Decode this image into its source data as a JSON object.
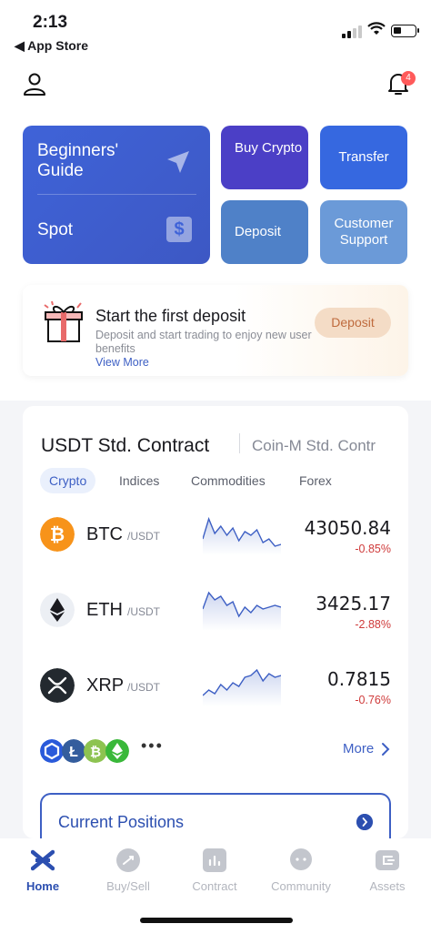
{
  "status_bar": {
    "time": "2:13",
    "back_app": "◀ App Store"
  },
  "header": {
    "notification_count": "4"
  },
  "quick_actions": {
    "beginners_guide": "Beginners' Guide",
    "spot": "Spot",
    "buy_crypto": "Buy Crypto",
    "transfer": "Transfer",
    "deposit": "Deposit",
    "customer_support": "Customer Support"
  },
  "promo": {
    "title": "Start the first deposit",
    "description": "Deposit and start trading to enjoy new user benefits",
    "link": "View More",
    "button": "Deposit"
  },
  "market": {
    "tabs": [
      "USDT Std. Contract",
      "Coin-M Std. Contr"
    ],
    "chips": [
      "Crypto",
      "Indices",
      "Commodities",
      "Forex"
    ],
    "coins": [
      {
        "symbol": "BTC",
        "pair": "/USDT",
        "price": "43050.84",
        "change": "-0.85%",
        "logo_color": "#f7931a",
        "sparkline": [
          0.7,
          0.15,
          0.55,
          0.35,
          0.6,
          0.4,
          0.75,
          0.5,
          0.6,
          0.45,
          0.8,
          0.7,
          0.9,
          0.85
        ]
      },
      {
        "symbol": "ETH",
        "pair": "/USDT",
        "price": "3425.17",
        "change": "-2.88%",
        "logo_color": "#627eea",
        "sparkline": [
          0.55,
          0.1,
          0.3,
          0.2,
          0.45,
          0.35,
          0.75,
          0.5,
          0.65,
          0.45,
          0.55,
          0.5,
          0.45,
          0.5
        ]
      },
      {
        "symbol": "XRP",
        "pair": "/USDT",
        "price": "0.7815",
        "change": "-0.76%",
        "logo_color": "#23292f",
        "sparkline": [
          0.85,
          0.7,
          0.8,
          0.55,
          0.7,
          0.5,
          0.6,
          0.35,
          0.3,
          0.15,
          0.45,
          0.25,
          0.35,
          0.3
        ]
      }
    ],
    "more_label": "More",
    "dots": "•••",
    "current_positions": "Current Positions"
  },
  "tab_bar": {
    "items": [
      {
        "label": "Home",
        "icon": "home-logo-icon"
      },
      {
        "label": "Buy/Sell",
        "icon": "buy-sell-icon"
      },
      {
        "label": "Contract",
        "icon": "contract-icon"
      },
      {
        "label": "Community",
        "icon": "community-icon"
      },
      {
        "label": "Assets",
        "icon": "assets-icon"
      }
    ]
  },
  "colors": {
    "accent": "#2c4fb0",
    "negative": "#cf3a3a",
    "promo_button_bg": "#f4dcc6"
  }
}
